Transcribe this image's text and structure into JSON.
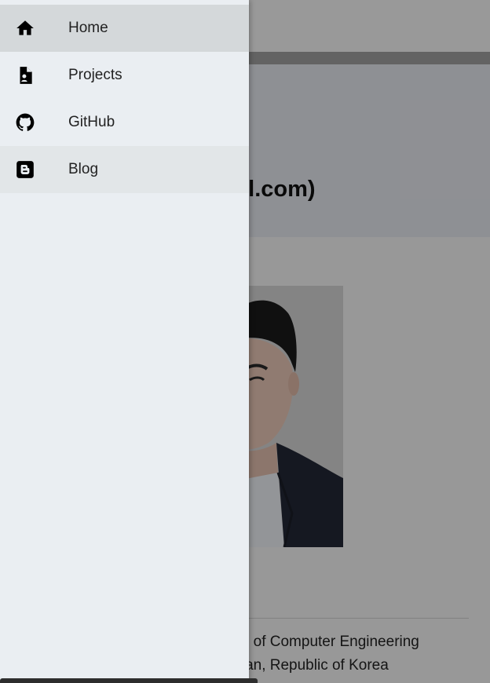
{
  "drawer": {
    "items": [
      {
        "label": "Home",
        "icon": "home-icon",
        "state": "active"
      },
      {
        "label": "Projects",
        "icon": "document-person-icon",
        "state": "normal"
      },
      {
        "label": "GitHub",
        "icon": "github-icon",
        "state": "normal"
      },
      {
        "label": "Blog",
        "icon": "blogger-icon",
        "state": "hover"
      }
    ]
  },
  "background": {
    "heading": "ail.com)",
    "lines": [
      "ool of Computer Engineering",
      "usan, Republic of Korea"
    ]
  },
  "colors": {
    "drawer_bg": "#eaeef2",
    "active_item": "#d4d8da",
    "hover_item": "#e2e6e8",
    "scrim": "rgba(0,0,0,0.38)"
  }
}
